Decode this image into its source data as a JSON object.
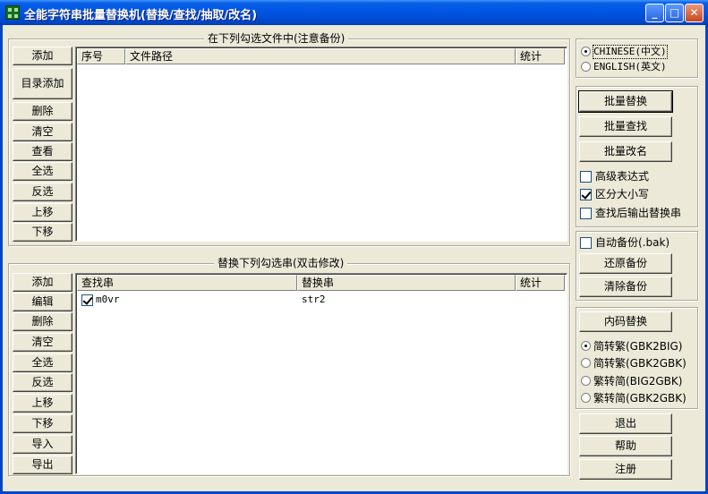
{
  "window": {
    "title": "全能字符串批量替换机(替换/查找/抽取/改名)"
  },
  "files_group": {
    "label": "在下列勾选文件中(注意备份)",
    "buttons": [
      "添加",
      "目录添加",
      "删除",
      "清空",
      "查看",
      "全选",
      "反选",
      "上移",
      "下移"
    ],
    "columns": [
      "序号",
      "文件路径",
      "统计"
    ],
    "rows": []
  },
  "replace_group": {
    "label": "替换下列勾选串(双击修改)",
    "buttons": [
      "添加",
      "编辑",
      "删除",
      "清空",
      "全选",
      "反选",
      "上移",
      "下移",
      "导入",
      "导出"
    ],
    "columns": [
      "查找串",
      "替换串",
      "统计"
    ],
    "rows": [
      {
        "checked": true,
        "find": "m0vr",
        "replace": "str2",
        "count": ""
      }
    ]
  },
  "language": {
    "options": [
      "CHINESE(中文)",
      "ENGLISH(英文)"
    ],
    "selected": "CHINESE(中文)"
  },
  "actions": {
    "buttons": [
      "批量替换",
      "批量查找",
      "批量改名"
    ],
    "checkboxes": [
      {
        "label": "高级表达式",
        "checked": false
      },
      {
        "label": "区分大小写",
        "checked": true
      },
      {
        "label": "查找后输出替换串",
        "checked": false
      }
    ]
  },
  "backup": {
    "auto_backup": {
      "label": "自动备份(.bak)",
      "checked": false
    },
    "restore_label": "还原备份",
    "clear_label": "清除备份"
  },
  "encoding": {
    "button_label": "内码替换",
    "options": [
      "简转繁(GBK2BIG)",
      "简转繁(GBK2GBK)",
      "繁转简(BIG2GBK)",
      "繁转简(GBK2GBK)"
    ],
    "selected": "简转繁(GBK2BIG)"
  },
  "bottom": {
    "exit_label": "退出",
    "help_label": "帮助",
    "register_label": "注册"
  },
  "colors": {
    "titlebar": "#0054E3",
    "face": "#ECE9D8"
  }
}
